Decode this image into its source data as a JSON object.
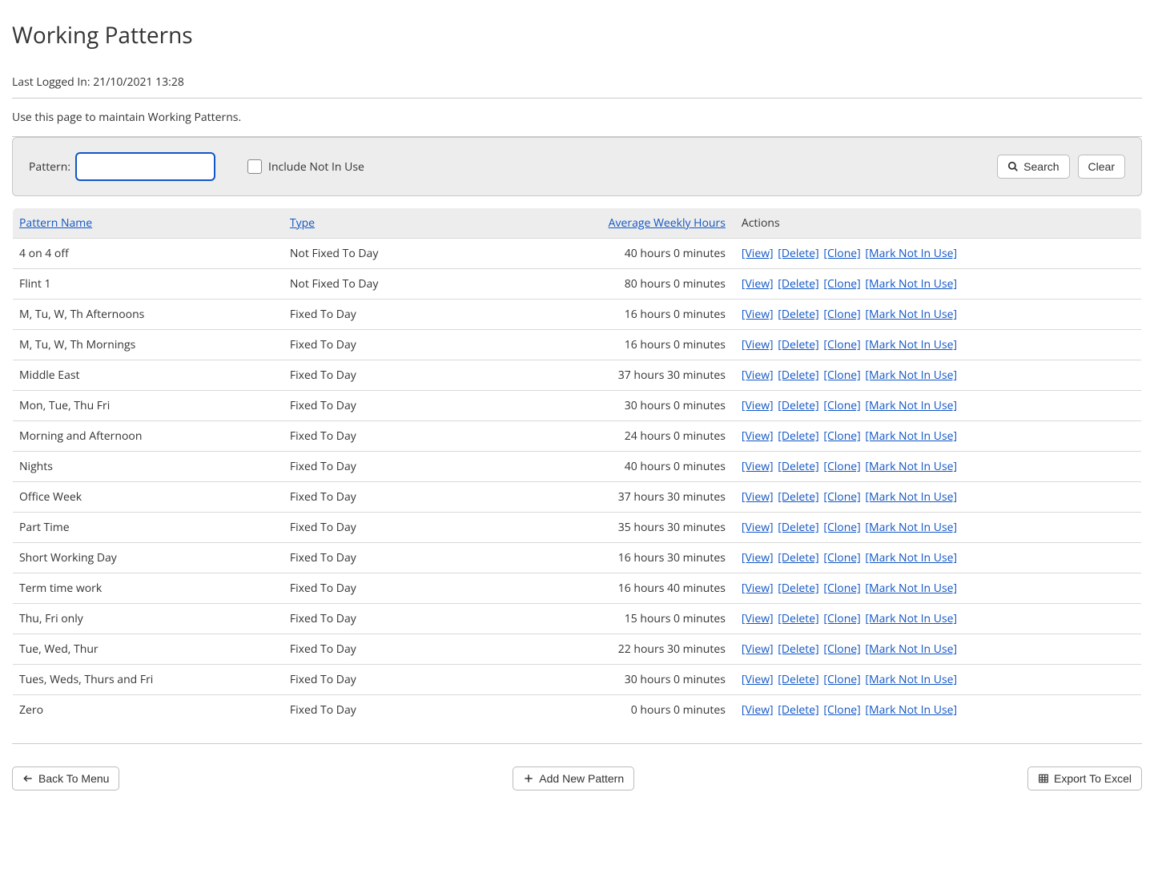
{
  "page": {
    "title": "Working Patterns",
    "last_logged_in_label": "Last Logged In: 21/10/2021 13:28",
    "instruction": "Use this page to maintain Working Patterns."
  },
  "filter": {
    "pattern_label": "Pattern:",
    "pattern_value": "",
    "include_not_in_use_label": "Include Not In Use",
    "include_not_in_use_checked": false,
    "search_label": "Search",
    "clear_label": "Clear"
  },
  "table": {
    "col_pattern_name": "Pattern Name",
    "col_type": "Type",
    "col_avg_hours": "Average Weekly Hours",
    "col_actions": "Actions",
    "action_view": "[View]",
    "action_delete": "[Delete]",
    "action_clone": "[Clone]",
    "action_mark": "[Mark Not In Use]",
    "rows": [
      {
        "name": "4 on 4 off",
        "type": "Not Fixed To Day",
        "hours": "40 hours 0 minutes"
      },
      {
        "name": "Flint 1",
        "type": "Not Fixed To Day",
        "hours": "80 hours 0 minutes"
      },
      {
        "name": "M, Tu, W, Th Afternoons",
        "type": "Fixed To Day",
        "hours": "16 hours 0 minutes"
      },
      {
        "name": "M, Tu, W, Th Mornings",
        "type": "Fixed To Day",
        "hours": "16 hours 0 minutes"
      },
      {
        "name": "Middle East",
        "type": "Fixed To Day",
        "hours": "37 hours 30 minutes"
      },
      {
        "name": "Mon, Tue, Thu Fri",
        "type": "Fixed To Day",
        "hours": "30 hours 0 minutes"
      },
      {
        "name": "Morning and Afternoon",
        "type": "Fixed To Day",
        "hours": "24 hours 0 minutes"
      },
      {
        "name": "Nights",
        "type": "Fixed To Day",
        "hours": "40 hours 0 minutes"
      },
      {
        "name": "Office Week",
        "type": "Fixed To Day",
        "hours": "37 hours 30 minutes"
      },
      {
        "name": "Part Time",
        "type": "Fixed To Day",
        "hours": "35 hours 30 minutes"
      },
      {
        "name": "Short Working Day",
        "type": "Fixed To Day",
        "hours": "16 hours 30 minutes"
      },
      {
        "name": "Term time work",
        "type": "Fixed To Day",
        "hours": "16 hours 40 minutes"
      },
      {
        "name": "Thu, Fri only",
        "type": "Fixed To Day",
        "hours": "15 hours 0 minutes"
      },
      {
        "name": "Tue, Wed, Thur",
        "type": "Fixed To Day",
        "hours": "22 hours 30 minutes"
      },
      {
        "name": "Tues, Weds, Thurs and Fri",
        "type": "Fixed To Day",
        "hours": "30 hours 0 minutes"
      },
      {
        "name": "Zero",
        "type": "Fixed To Day",
        "hours": "0 hours 0 minutes"
      }
    ]
  },
  "footer": {
    "back_label": "Back To Menu",
    "add_label": "Add New Pattern",
    "export_label": "Export To Excel"
  }
}
